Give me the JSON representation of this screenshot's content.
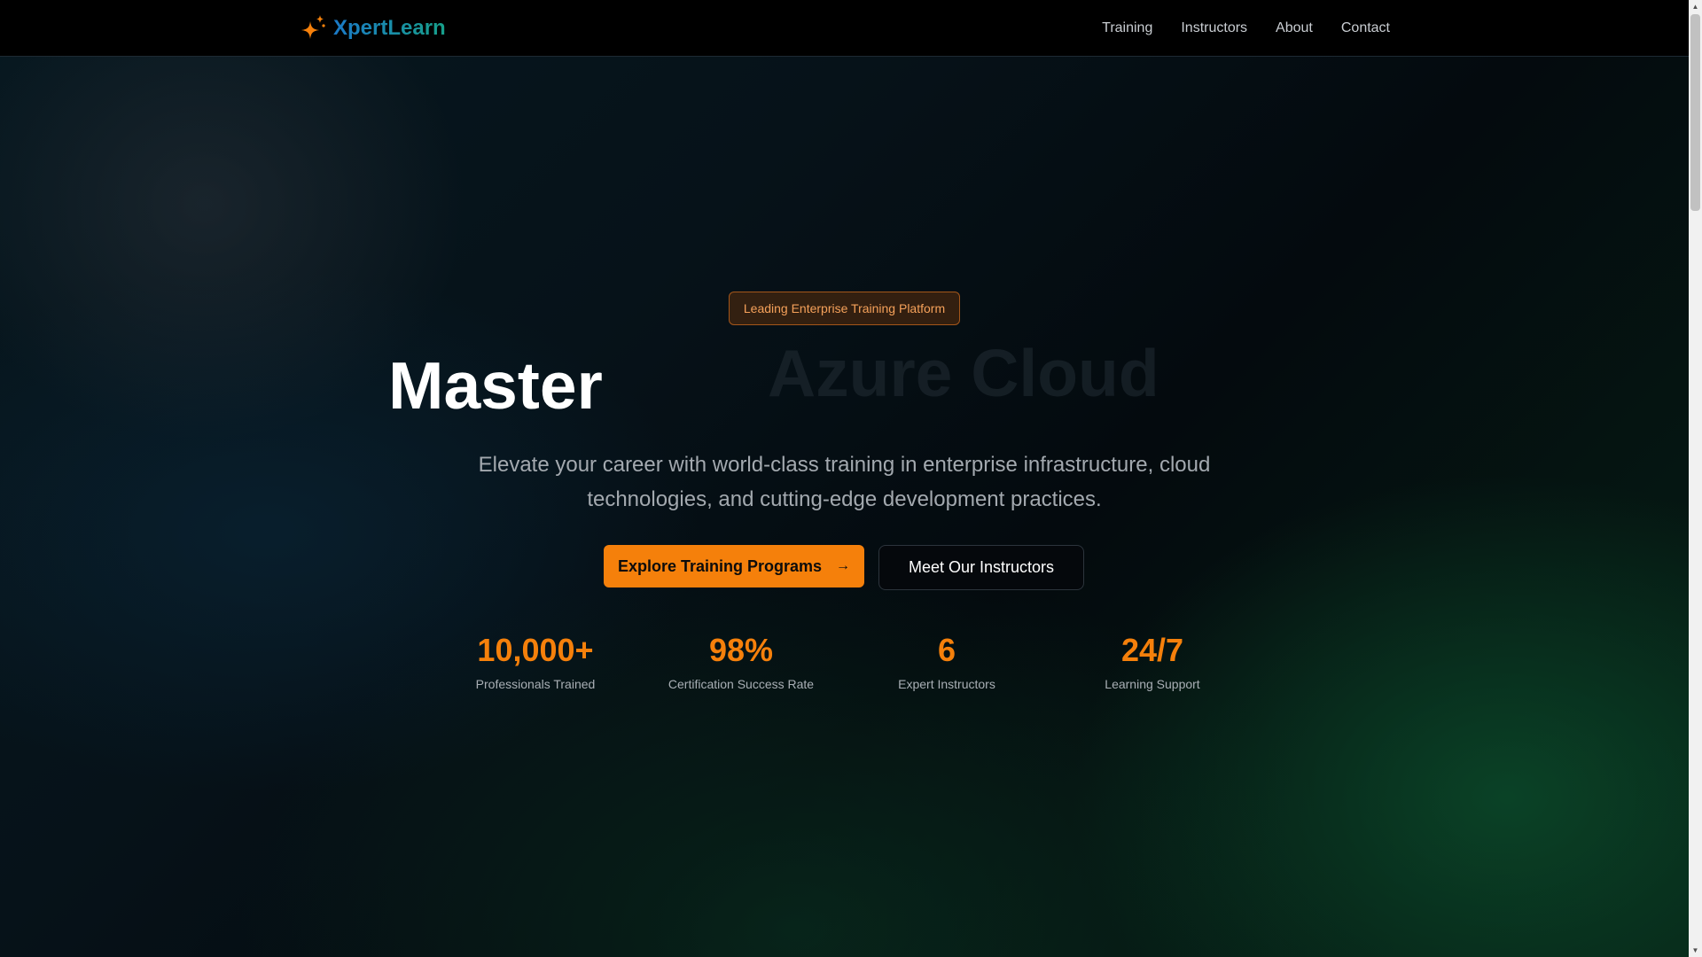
{
  "brand": {
    "name": "XpertLearn",
    "icon": "sparkle-icon",
    "gradient_from": "#1b79c7",
    "gradient_to": "#17a08a"
  },
  "nav": {
    "items": [
      {
        "label": "Training"
      },
      {
        "label": "Instructors"
      },
      {
        "label": "About"
      },
      {
        "label": "Contact"
      }
    ]
  },
  "hero": {
    "badge": "Leading Enterprise Training Platform",
    "heading_static": "Master",
    "heading_rotating": "Azure Cloud",
    "subtitle": "Elevate your career with world-class training in enterprise infrastructure, cloud technologies, and cutting-edge development practices.",
    "primary_cta": {
      "label": "Explore Training Programs",
      "icon": "arrow-right-icon",
      "glyph": "→"
    },
    "secondary_cta": {
      "label": "Meet Our Instructors"
    }
  },
  "stats": [
    {
      "value": "10,000+",
      "label": "Professionals Trained"
    },
    {
      "value": "98%",
      "label": "Certification Success Rate"
    },
    {
      "value": "6",
      "label": "Expert Instructors"
    },
    {
      "value": "24/7",
      "label": "Learning Support"
    }
  ],
  "colors": {
    "accent": "#f5800b",
    "background": "#05080c",
    "nav_background": "#000000"
  }
}
